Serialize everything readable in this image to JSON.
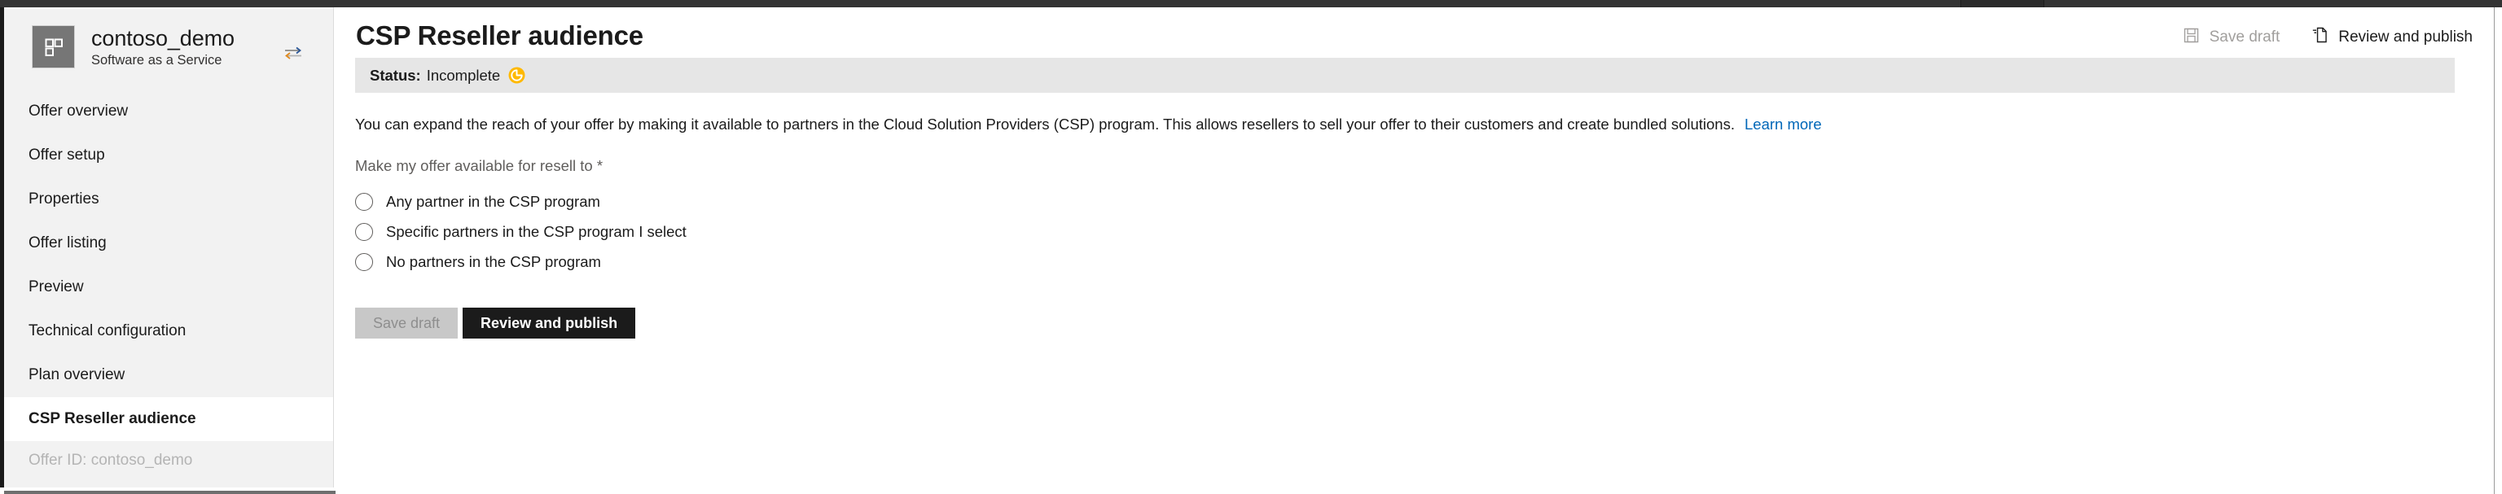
{
  "window": {
    "chrome_color": "#333333",
    "tab_segments": 3
  },
  "sidebar": {
    "offer_name": "contoso_demo",
    "offer_type": "Software as a Service",
    "logo_icon": "offer-blocks-icon",
    "swap_icon": "swap-arrows-icon",
    "items": [
      {
        "label": "Offer overview",
        "selected": false
      },
      {
        "label": "Offer setup",
        "selected": false
      },
      {
        "label": "Properties",
        "selected": false
      },
      {
        "label": "Offer listing",
        "selected": false
      },
      {
        "label": "Preview",
        "selected": false
      },
      {
        "label": "Technical configuration",
        "selected": false
      },
      {
        "label": "Plan overview",
        "selected": false
      },
      {
        "label": "CSP Reseller audience",
        "selected": true
      }
    ],
    "offer_id_label": "Offer ID: contoso_demo"
  },
  "header": {
    "title": "CSP Reseller audience",
    "actions": {
      "save_draft": {
        "label": "Save draft",
        "icon": "floppy-disk-icon",
        "enabled": false
      },
      "review_publish": {
        "label": "Review and publish",
        "icon": "publish-page-icon",
        "enabled": true
      }
    }
  },
  "status": {
    "label": "Status:",
    "value": "Incomplete",
    "icon": "pending-clock-icon",
    "icon_color": "#ffb900",
    "bar_color": "#e6e6e6"
  },
  "main": {
    "description": "You can expand the reach of your offer by making it available to partners in the Cloud Solution Providers (CSP) program. This allows resellers to sell your offer to their customers and create bundled solutions.",
    "learn_more": "Learn more",
    "field_label": "Make my offer available for resell to *",
    "options": [
      {
        "label": "Any partner in the CSP program",
        "checked": false
      },
      {
        "label": "Specific partners in the CSP program I select",
        "checked": false
      },
      {
        "label": "No partners in the CSP program",
        "checked": false
      }
    ],
    "buttons": {
      "save_draft": "Save draft",
      "review_publish": "Review and publish"
    }
  },
  "colors": {
    "link": "#0067b8",
    "primary_button": "#1b1b1b",
    "secondary_button": "#c8c8c8",
    "sidebar_bg": "#f2f2f2"
  }
}
